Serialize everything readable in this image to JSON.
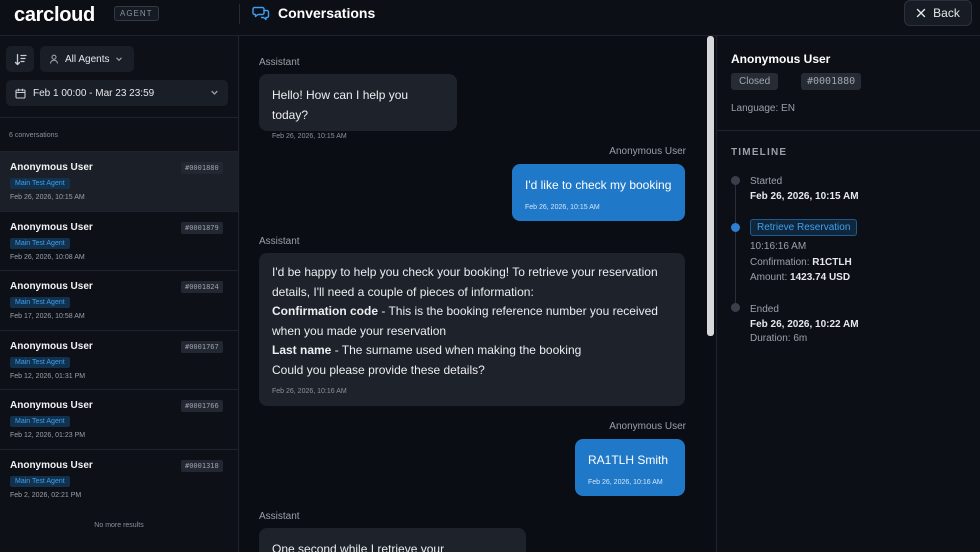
{
  "header": {
    "logo": "carcloud",
    "agent_badge": "AGENT",
    "title": "Conversations",
    "back_label": "Back"
  },
  "sidebar": {
    "agents_filter": "All Agents",
    "date_range": "Feb 1 00:00 - Mar 23 23:59",
    "count_label": "6 conversations",
    "no_more": "No more results",
    "conversations": [
      {
        "name": "Anonymous User",
        "id": "#0001880",
        "agent": "Main Test Agent",
        "date": "Feb 26, 2026, 10:15 AM"
      },
      {
        "name": "Anonymous User",
        "id": "#0001879",
        "agent": "Main Test Agent",
        "date": "Feb 26, 2026, 10:08 AM"
      },
      {
        "name": "Anonymous User",
        "id": "#0001824",
        "agent": "Main Test Agent",
        "date": "Feb 17, 2026, 10:58 AM"
      },
      {
        "name": "Anonymous User",
        "id": "#0001767",
        "agent": "Main Test Agent",
        "date": "Feb 12, 2026, 01:31 PM"
      },
      {
        "name": "Anonymous User",
        "id": "#0001766",
        "agent": "Main Test Agent",
        "date": "Feb 12, 2026, 01:23 PM"
      },
      {
        "name": "Anonymous User",
        "id": "#0001318",
        "agent": "Main Test Agent",
        "date": "Feb 2, 2026, 02:21 PM"
      }
    ]
  },
  "chat": {
    "assistant_label": "Assistant",
    "user_label": "Anonymous User",
    "messages": [
      {
        "text": "Hello! How can I help you today?",
        "time": "Feb 26, 2026, 10:15 AM"
      },
      {
        "text": "I'd like to check my booking",
        "time": "Feb 26, 2026, 10:15 AM"
      },
      {
        "line1": "I'd be happy to help you check your booking! To retrieve your reservation",
        "line2": "details, I'll need a couple of pieces of information:",
        "bold1": "Confirmation code",
        "rest1": " - This is the booking reference number you received",
        "line4": "when you made your reservation",
        "bold2": "Last name",
        "rest2": " - The surname used when making the booking",
        "line6": "Could you please provide these details?",
        "time": "Feb 26, 2026, 10:16 AM"
      },
      {
        "text": "RA1TLH Smith",
        "time": "Feb 26, 2026, 10:16 AM"
      },
      {
        "text": "One second while I retrieve your reservation..."
      }
    ]
  },
  "detail": {
    "name": "Anonymous User",
    "status": "Closed",
    "id": "#0001880",
    "language": "Language: EN",
    "timeline_title": "TIMELINE",
    "started_label": "Started",
    "started_time": "Feb 26, 2026, 10:15 AM",
    "tool_name": "Retrieve Reservation",
    "tool_time": "10:16:16 AM",
    "confirmation_label": "Confirmation:",
    "confirmation_value": "R1CTLH",
    "amount_label": "Amount:",
    "amount_value": "1423.74 USD",
    "ended_label": "Ended",
    "ended_time": "Feb 26, 2026, 10:22 AM",
    "duration": "Duration: 6m"
  },
  "colors": {
    "accent": "#1f78c8",
    "background": "#0c0f16",
    "bubble_assistant": "#1e222a"
  }
}
